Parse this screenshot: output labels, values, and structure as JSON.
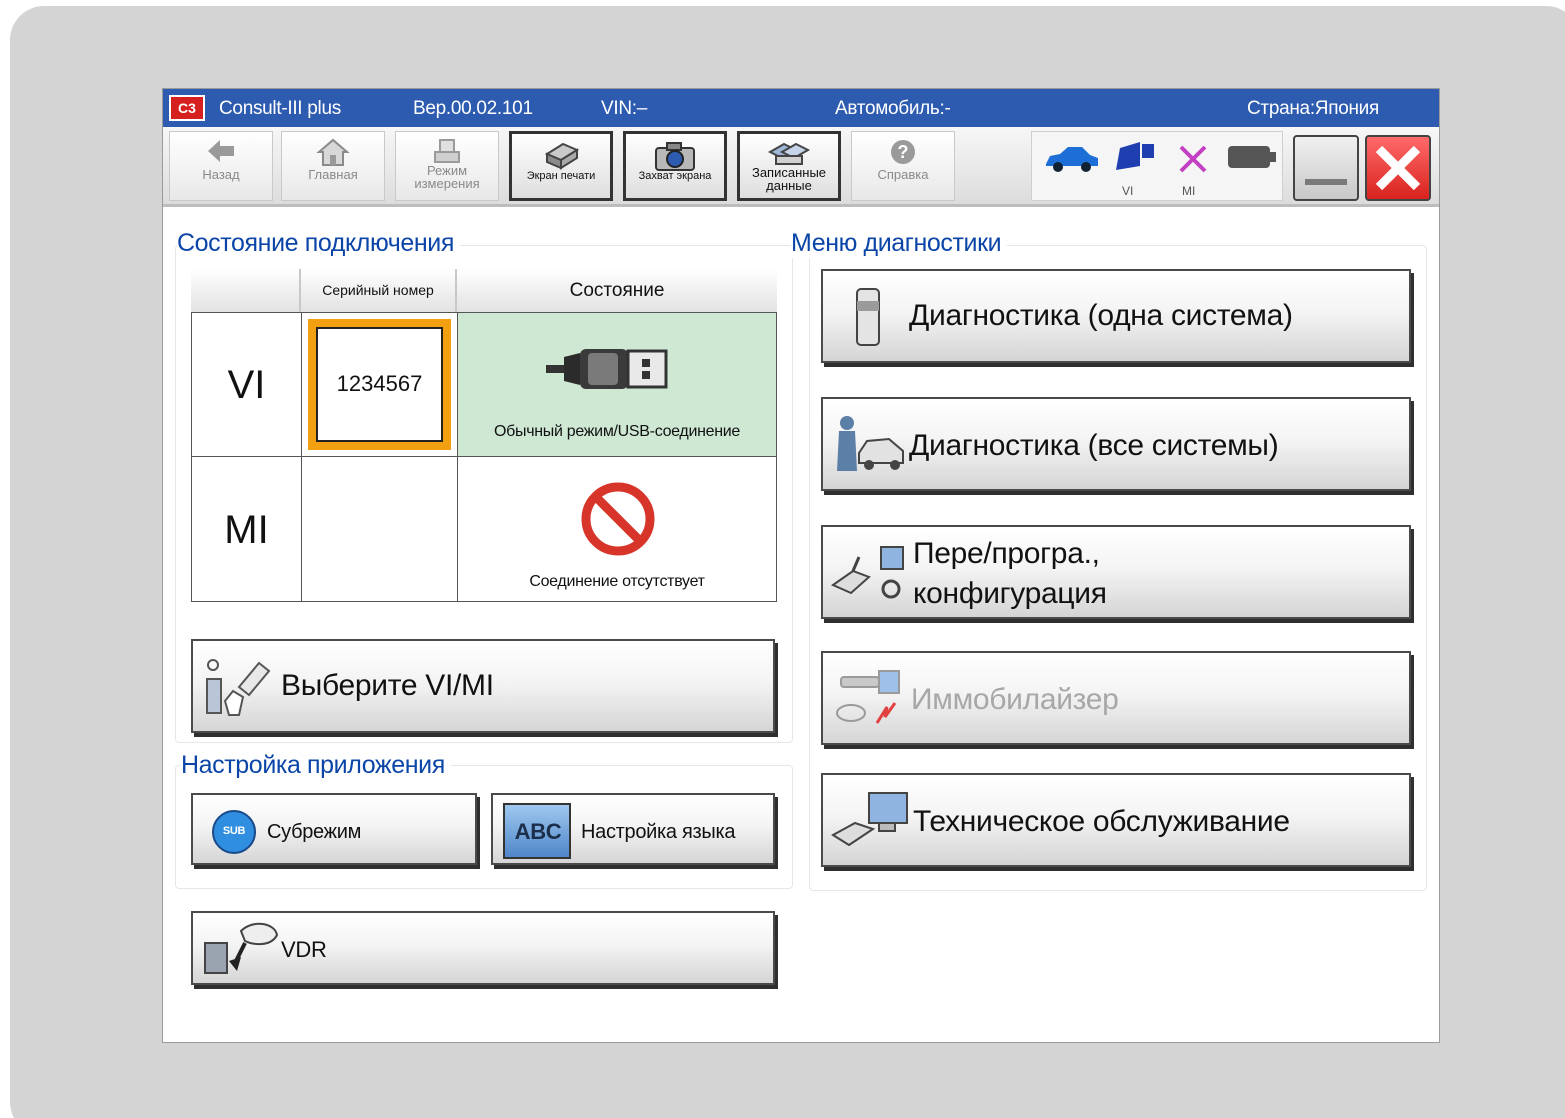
{
  "titlebar": {
    "logo": "C3",
    "app_name": "Consult-III plus",
    "version": "Вер.00.02.101",
    "vin": "VIN:–",
    "vehicle": "Автомобиль:-",
    "country": "Страна:Япония"
  },
  "toolbar": {
    "back": "Назад",
    "home": "Главная",
    "measure": "Режим измерения",
    "print": "Экран печати",
    "capture": "Захват экрана",
    "recorded": "Записанные данные",
    "help": "Справка",
    "vi": "VI",
    "mi": "MI"
  },
  "connection": {
    "title": "Состояние подключения",
    "col_serial": "Серийный номер",
    "col_state": "Состояние",
    "rows": [
      {
        "device": "VI",
        "serial": "1234567",
        "state": "Обычный режим/USB-соединение"
      },
      {
        "device": "MI",
        "serial": "",
        "state": "Соединение отсутствует"
      }
    ],
    "select_button": "Выберите VI/MI"
  },
  "app_settings": {
    "title": "Настройка приложения",
    "submode": "Субрежим",
    "submode_badge": "SUB",
    "language": "Настройка языка",
    "language_badge": "ABC"
  },
  "vdr": {
    "label": "VDR"
  },
  "diagnostics": {
    "title": "Меню диагностики",
    "single": "Диагностика (одна система)",
    "all": "Диагностика (все системы)",
    "reprog_line1": "Пере/програ.,",
    "reprog_line2": "конфигурация",
    "immobilizer": "Иммобилайзер",
    "maintenance": "Техническое обслуживание"
  },
  "colors": {
    "titlebar": "#2d5bb0",
    "section_title": "#0b45a8",
    "selection": "#f2a012",
    "connected_bg": "#cfe8d4",
    "close": "#d8231d"
  }
}
